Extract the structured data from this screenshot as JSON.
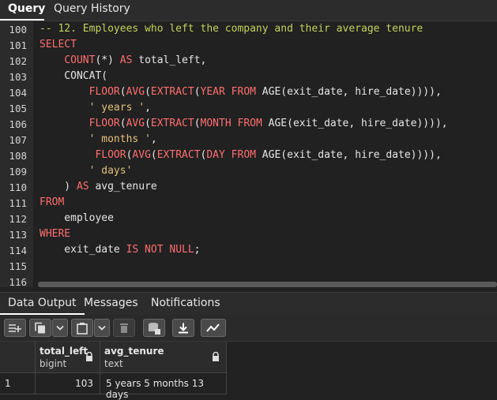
{
  "top_tabs": [
    {
      "label": "Query"
    },
    {
      "label": "Query History"
    }
  ],
  "editor": {
    "line_numbers": [
      "100",
      "101",
      "102",
      "103",
      "104",
      "105",
      "106",
      "107",
      "108",
      "109",
      "110",
      "111",
      "112",
      "113",
      "114",
      "115",
      "116"
    ]
  },
  "bottom_tabs": [
    {
      "label": "Data Output"
    },
    {
      "label": "Messages"
    },
    {
      "label": "Notifications"
    }
  ],
  "toolbar": {
    "icons": [
      "add-row-icon",
      "copy-icon",
      "dropdown-icon",
      "paste-icon",
      "dropdown-icon",
      "delete-icon",
      "save-data-icon",
      "download-icon",
      "graph-icon"
    ]
  },
  "grid": {
    "columns": [
      {
        "name": "total_left",
        "type": "bigint"
      },
      {
        "name": "avg_tenure",
        "type": "text"
      }
    ],
    "rows": [
      {
        "row_num": "1",
        "total_left": "103",
        "avg_tenure": "5 years 5 months 13 days"
      }
    ]
  },
  "colors": {
    "keyword": "#ff6e6e",
    "string": "#e5c07b",
    "comment": "#c5d25a",
    "accent": "#ffffff"
  }
}
